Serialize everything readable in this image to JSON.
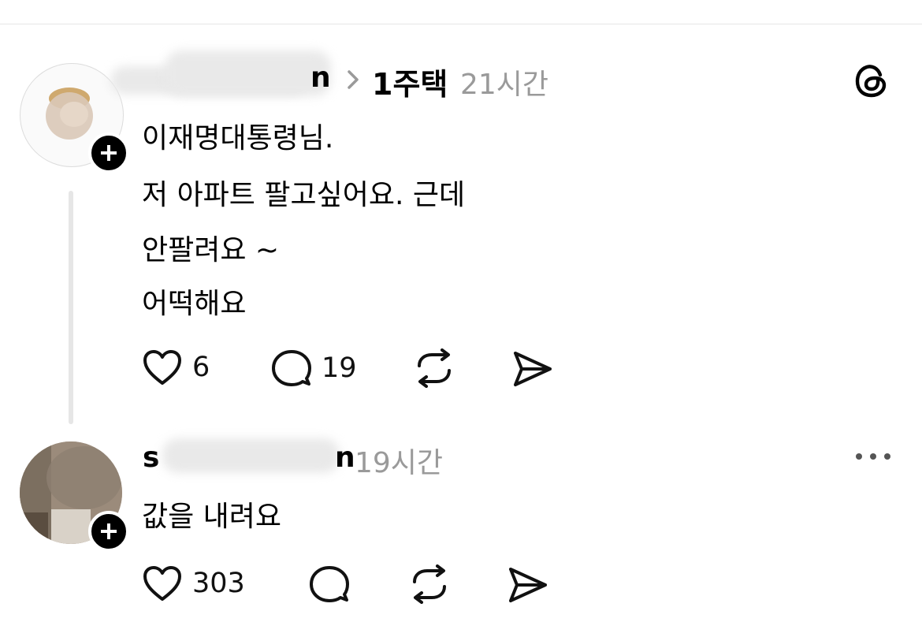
{
  "post": {
    "username_visible_end": "n",
    "topic": "1주택",
    "time": "21시간",
    "lines": [
      "이재명대통령님.",
      "저 아파트 팔고싶어요. 근데",
      "안팔려요 ~",
      "어떡해요"
    ],
    "likes": "6",
    "replies": "19"
  },
  "reply": {
    "username_visible_start": "s",
    "username_visible_end": "n",
    "time": "19시간",
    "text": "값을 내려요",
    "likes": "303"
  },
  "icons": {
    "threads_logo": "threads-logo-icon",
    "like": "heart-icon",
    "comment": "comment-bubble-icon",
    "repost": "repost-icon",
    "share": "send-icon",
    "more": "more-dots-icon",
    "follow": "plus-icon"
  },
  "colors": {
    "text": "#000000",
    "muted": "#9a9a9a",
    "divider": "#e6e6e6"
  }
}
